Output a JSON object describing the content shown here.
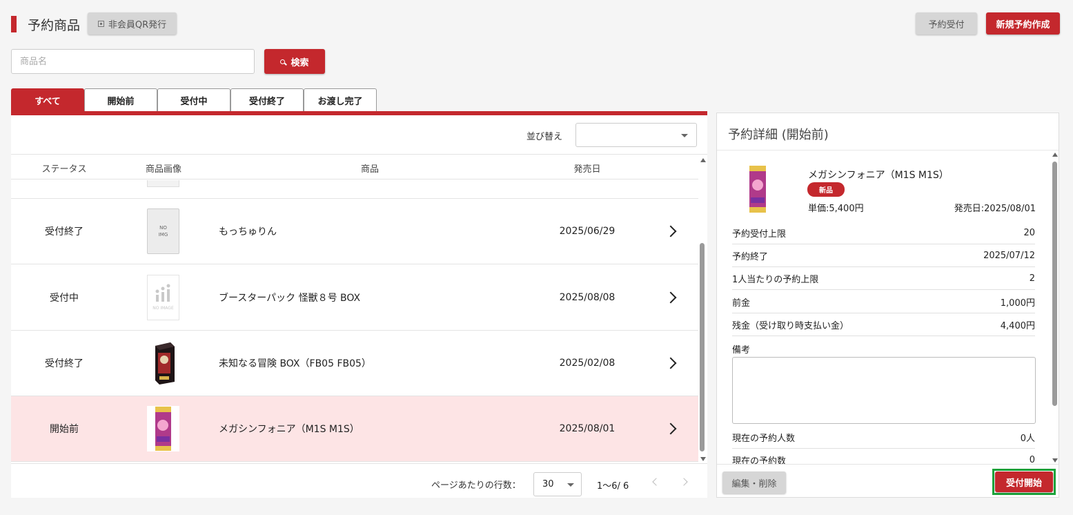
{
  "header": {
    "title": "予約商品",
    "qr_button": "非会員QR発行",
    "reserve_accept_button": "予約受付",
    "new_reservation_button": "新規予約作成"
  },
  "search": {
    "placeholder": "商品名",
    "value": "",
    "button": "検索"
  },
  "tabs": [
    "すべて",
    "開始前",
    "受付中",
    "受付終了",
    "お渡し完了"
  ],
  "active_tab": "すべて",
  "sort": {
    "label": "並び替え",
    "value": ""
  },
  "table": {
    "headers": [
      "ステータス",
      "商品画像",
      "商品",
      "発売日"
    ],
    "rows": [
      {
        "status": "受付終了",
        "image": "no-img",
        "image_text": "NO IMG",
        "name": "もっちゅりん",
        "release": "2025/06/29",
        "selected": false
      },
      {
        "status": "受付中",
        "image": "no-image",
        "image_text": "NO IMAGE",
        "name": "ブースターパック 怪獣８号 BOX",
        "release": "2025/08/08",
        "selected": false
      },
      {
        "status": "受付終了",
        "image": "product-box",
        "image_text": "",
        "name": "未知なる冒険 BOX（FB05 FB05）",
        "release": "2025/02/08",
        "selected": false
      },
      {
        "status": "開始前",
        "image": "product-pack",
        "image_text": "",
        "name": "メガシンフォニア（M1S M1S）",
        "release": "2025/08/01",
        "selected": true
      }
    ]
  },
  "pagination": {
    "rows_per_page_label": "ページあたりの行数：",
    "rows_per_page": "30",
    "range": "1〜6/ 6"
  },
  "detail": {
    "title": "予約詳細 (開始前)",
    "product_name": "メガシンフォニア（M1S M1S）",
    "badge": "新品",
    "unit_price": "単価:5,400円",
    "release_date": "発売日:2025/08/01",
    "fields": [
      {
        "label": "予約受付上限",
        "value": "20"
      },
      {
        "label": "予約終了",
        "value": "2025/07/12"
      },
      {
        "label": "1人当たりの予約上限",
        "value": "2"
      },
      {
        "label": "前金",
        "value": "1,000円"
      },
      {
        "label": "残金（受け取り時支払い金）",
        "value": "4,400円"
      }
    ],
    "note_label": "備考",
    "note_value": "",
    "stats": [
      {
        "label": "現在の予約人数",
        "value": "0人"
      },
      {
        "label": "現在の予約数",
        "value": "0"
      }
    ],
    "edit_button": "編集・削除",
    "start_button": "受付開始"
  },
  "colors": {
    "accent": "#c4282d",
    "selected_row": "#fde4e5",
    "highlight_border": "#1ca33a"
  }
}
